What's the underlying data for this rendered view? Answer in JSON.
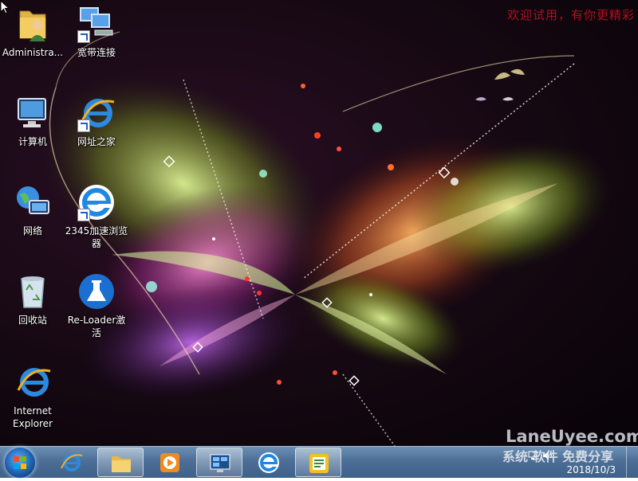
{
  "desktop": {
    "welcome_text": "欢迎试用，有你更精彩",
    "icons": [
      {
        "label": "Administra..."
      },
      {
        "label": "宽带连接"
      },
      {
        "label": "计算机"
      },
      {
        "label": "网址之家"
      },
      {
        "label": "网络"
      },
      {
        "label": "2345加速浏览器"
      },
      {
        "label": "回收站"
      },
      {
        "label": "Re-Loader激活"
      },
      {
        "label": "Internet Explorer"
      }
    ]
  },
  "taskbar": {
    "pinned": [
      "start-orb",
      "internet-explorer",
      "windows-explorer",
      "media-player",
      "remote-desktop",
      "2345-browser",
      "notepad-app"
    ],
    "clock_date": "2018/10/3"
  },
  "watermark": {
    "site": "LaneUyee.com",
    "tagline": "系统 软件 免费分享"
  }
}
